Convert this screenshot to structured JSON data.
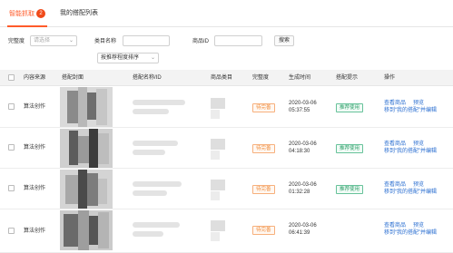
{
  "tabs": [
    {
      "label": "智能抓取",
      "badge": "2",
      "active": true
    },
    {
      "label": "我的搭配列表",
      "active": false
    }
  ],
  "filters": {
    "match_label": "完整度",
    "match_placeholder": "请选择",
    "category_label": "类目名称",
    "category_value": "",
    "product_id_label": "商品ID",
    "product_id_value": "",
    "search_button": "搜索",
    "sort_value": "按推荐程度排序"
  },
  "table": {
    "headers": [
      "内容来源",
      "搭配封面",
      "搭配名称/ID",
      "商品类目",
      "完整度",
      "生成时间",
      "搭配提示",
      "操作"
    ],
    "rows": [
      {
        "source": "算法创作",
        "status": "待完善",
        "date": "2020-03-06",
        "time": "05:37:55",
        "tip": "推荐使用",
        "action_view": "查看商品",
        "action_preview": "预览",
        "action_move": "移到“我的搭配”并编辑"
      },
      {
        "source": "算法创作",
        "status": "待完善",
        "date": "2020-03-06",
        "time": "04:18:30",
        "tip": "推荐使用",
        "action_view": "查看商品",
        "action_preview": "预览",
        "action_move": "移到“我的搭配”并编辑"
      },
      {
        "source": "算法创作",
        "status": "待完善",
        "date": "2020-03-06",
        "time": "01:32:28",
        "tip": "推荐使用",
        "action_view": "查看商品",
        "action_preview": "预览",
        "action_move": "移到“我的搭配”并编辑"
      },
      {
        "source": "算法创作",
        "status": "待完善",
        "date": "2020-03-06",
        "time": "06:41:39",
        "tip": "",
        "action_view": "查看商品",
        "action_preview": "预览",
        "action_move": "移到“我的搭配”并编辑"
      }
    ]
  },
  "colors": {
    "accent": "#ff5b2a",
    "link": "#2b6fd1",
    "status_orange": "#f08a3a",
    "tip_green": "#2ea06a"
  }
}
